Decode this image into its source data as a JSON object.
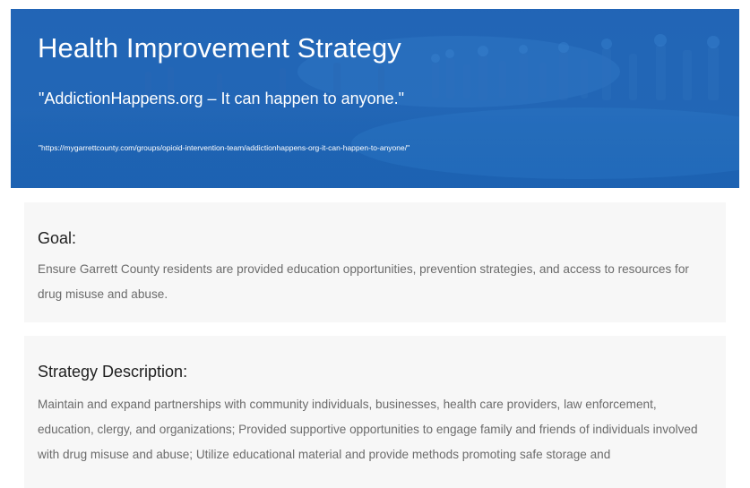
{
  "hero": {
    "title": "Health Improvement Strategy",
    "subtitle": "\"AddictionHappens.org – It can happen to anyone.\"",
    "url_text": "\"https://mygarrettcounty.com/groups/opioid-intervention-team/addictionhappens-org-it-can-happen-to-anyone/\""
  },
  "goal": {
    "heading": "Goal:",
    "body": "Ensure Garrett County residents are provided education opportunities, prevention strategies, and access to resources for drug misuse and abuse."
  },
  "strategy": {
    "heading": "Strategy Description:",
    "body": "Maintain and expand partnerships with community individuals, businesses, health care providers, law enforcement, education, clergy, and organizations; Provided supportive opportunities to engage family and friends of individuals involved with drug misuse and abuse; Utilize educational material and provide methods promoting safe storage and"
  },
  "colors": {
    "hero_blue": "#1a5ead",
    "card_background": "#f7f7f7",
    "heading_text": "#1f1f1f",
    "body_text": "#6b6b6b"
  }
}
